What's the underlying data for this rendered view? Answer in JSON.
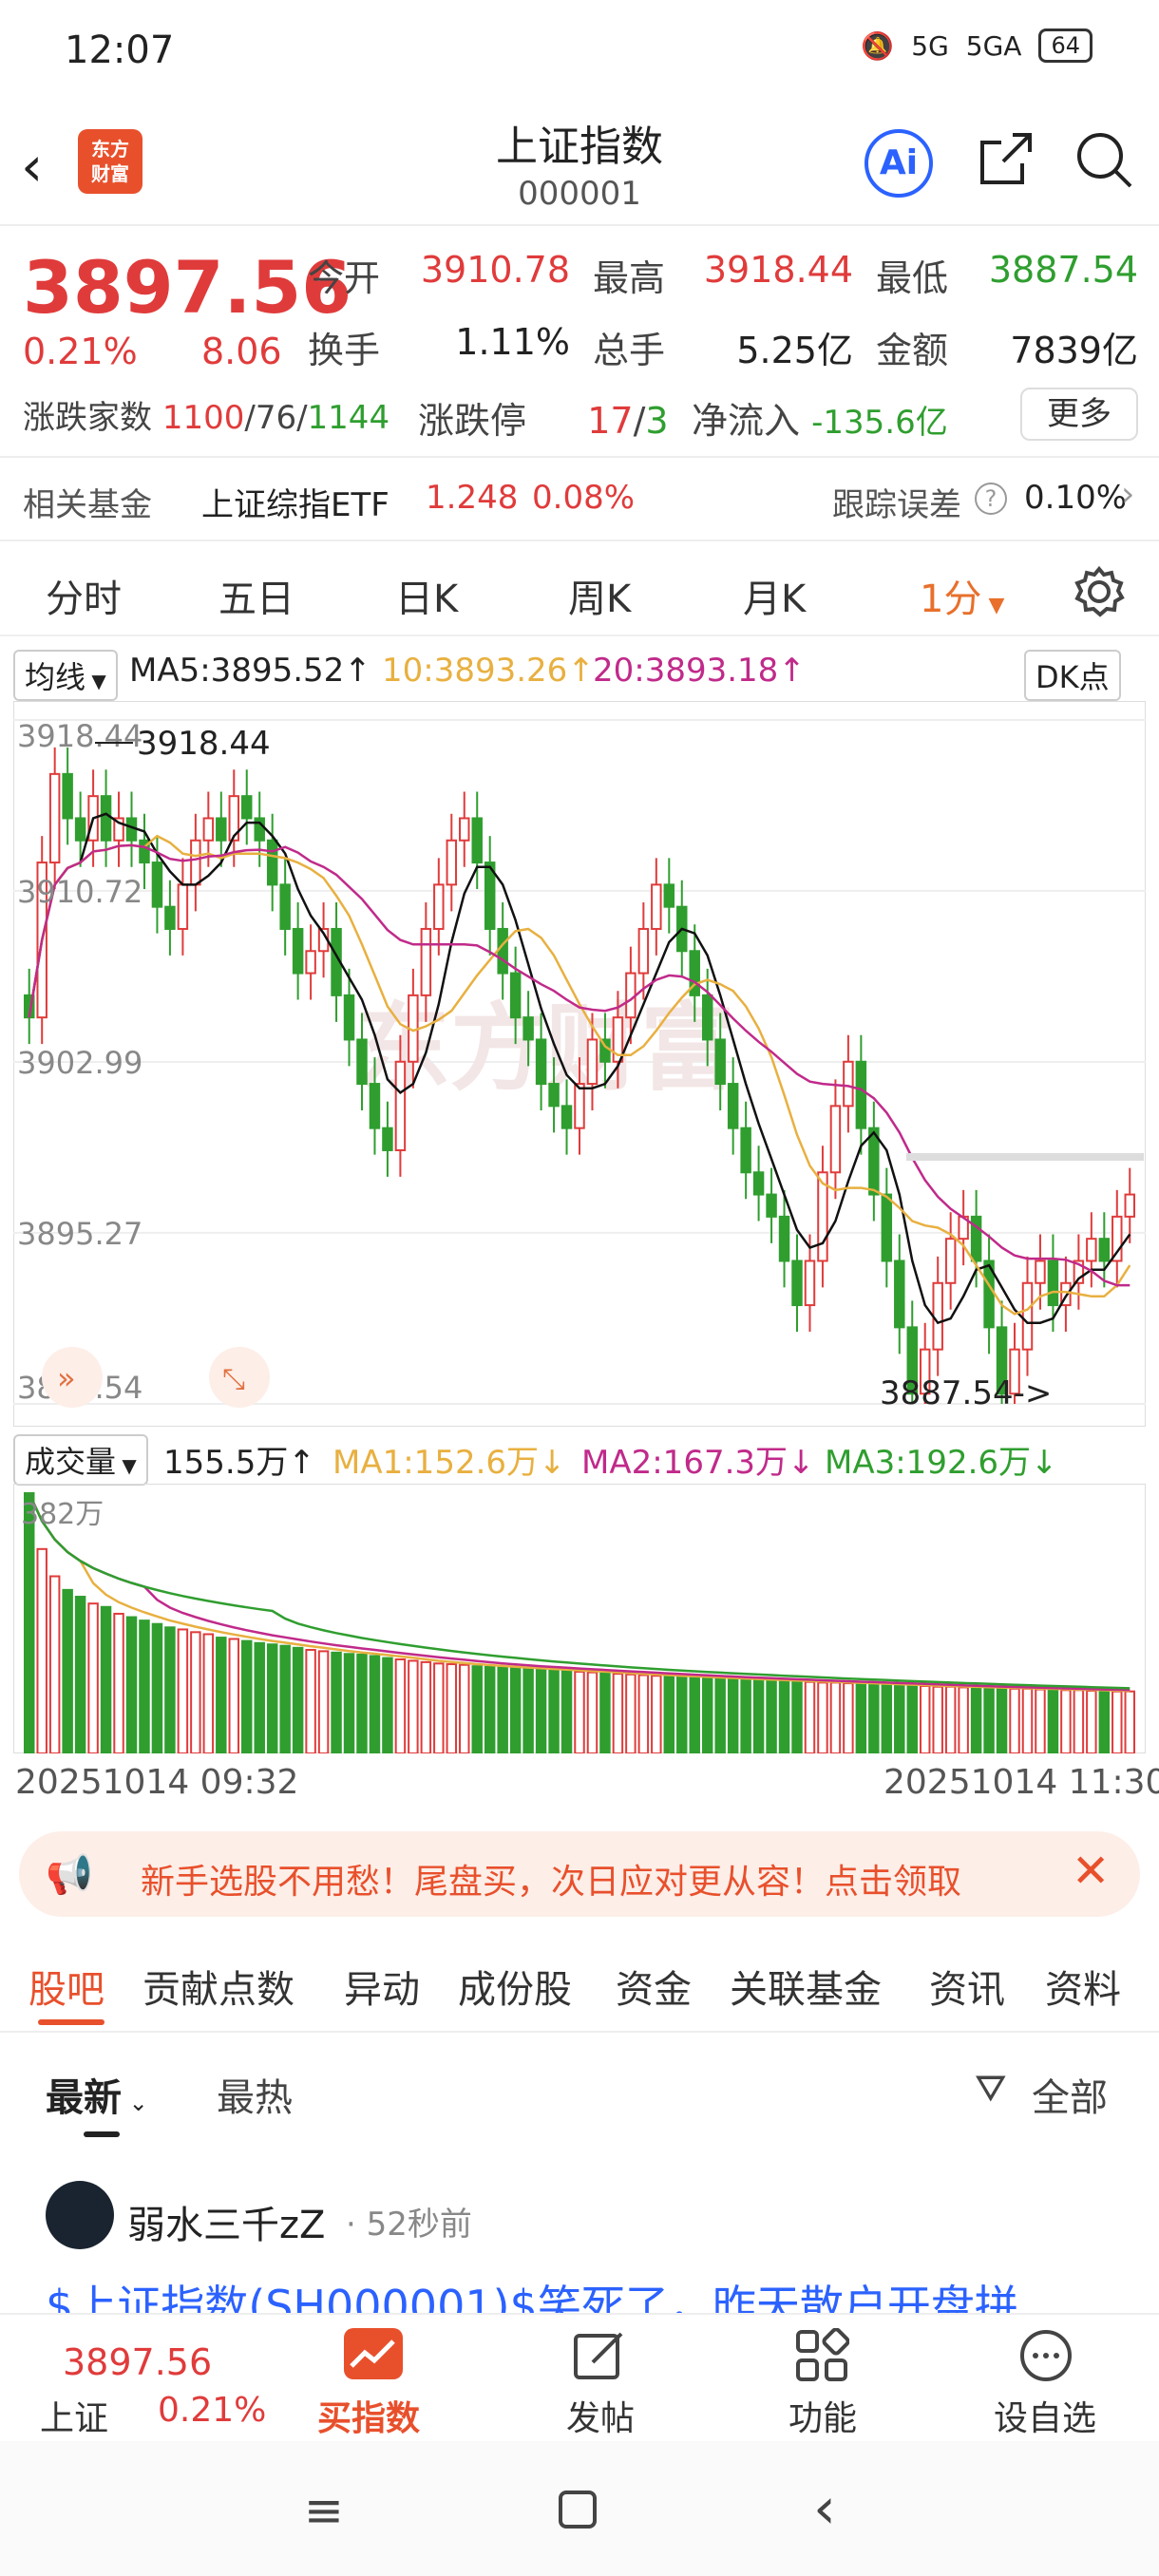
{
  "status": {
    "time": "12:07",
    "network1": "5G",
    "network2": "5GA",
    "battery": "64"
  },
  "header": {
    "title": "上证指数",
    "code": "000001",
    "logo_text": "东方\n财富",
    "ai_label": "Ai"
  },
  "quote": {
    "price": "3897.56",
    "change_pct": "0.21%",
    "change": "8.06",
    "open_label": "今开",
    "open": "3910.78",
    "high_label": "最高",
    "high": "3918.44",
    "low_label": "最低",
    "low": "3887.54",
    "turnover_label": "换手",
    "turnover": "1.11%",
    "volume_label": "总手",
    "volume": "5.25亿",
    "amount_label": "金额",
    "amount": "7839亿",
    "breadth_label": "涨跌家数",
    "breadth_up": "1100",
    "breadth_flat": "76",
    "breadth_down": "1144",
    "limit_label": "涨跌停",
    "limit_up": "17",
    "limit_down": "3",
    "netflow_label": "净流入",
    "netflow": "-135.6亿",
    "more_label": "更多"
  },
  "fund": {
    "label": "相关基金",
    "name": "上证综指ETF",
    "price": "1.248",
    "pct": "0.08%",
    "tracking_label": "跟踪误差",
    "tracking": "0.10%"
  },
  "kline_tabs": [
    "分时",
    "五日",
    "日K",
    "周K",
    "月K",
    "1分"
  ],
  "ma": {
    "selector": "均线",
    "ma5": "MA5:3895.52↑",
    "ma10": "10:3893.26↑",
    "ma20": "20:3893.18↑",
    "dk": "DK点"
  },
  "chart_data": {
    "type": "candlestick",
    "y_ticks": [
      "3918.44",
      "3910.72",
      "3902.99",
      "3895.27",
      "3887.54"
    ],
    "ylim": [
      3887.54,
      3918.44
    ],
    "high_annotation": "3918.44",
    "low_annotation": "3887.54->",
    "start_time": "20251014 09:32",
    "end_time": "20251014 11:30",
    "closes": [
      3905,
      3912,
      3916,
      3914,
      3913,
      3915,
      3913,
      3914,
      3913,
      3912,
      3910,
      3909,
      3911,
      3913,
      3914,
      3913,
      3915,
      3914,
      3913,
      3911,
      3909,
      3907,
      3908,
      3909,
      3906,
      3904,
      3902,
      3900,
      3899,
      3903,
      3906,
      3909,
      3911,
      3913,
      3914,
      3912,
      3909,
      3907,
      3905,
      3904,
      3902,
      3901,
      3900,
      3902,
      3904,
      3903,
      3905,
      3907,
      3909,
      3911,
      3910,
      3908,
      3906,
      3904,
      3902,
      3900,
      3898,
      3897,
      3896,
      3894,
      3892,
      3894,
      3898,
      3901,
      3903,
      3900,
      3897,
      3894,
      3891,
      3888,
      3890,
      3893,
      3895,
      3896,
      3894,
      3891,
      3888,
      3890,
      3893,
      3894,
      3892,
      3893,
      3894,
      3895,
      3894,
      3896,
      3897
    ],
    "volume": {
      "label": "成交量",
      "value": "155.5万↑",
      "ma1": "MA1:152.6万↓",
      "ma2": "MA2:167.3万↓",
      "ma3": "MA3:192.6万↓",
      "max_label": "382万",
      "values": [
        382,
        300,
        260,
        240,
        230,
        220,
        215,
        205,
        200,
        195,
        190,
        185,
        182,
        178,
        175,
        170,
        168,
        165,
        162,
        160,
        158,
        155,
        152,
        150,
        148,
        146,
        145,
        143,
        140,
        138,
        136,
        134,
        132,
        131,
        130,
        128,
        127,
        126,
        125,
        124,
        123,
        122,
        121,
        120,
        119,
        118,
        117,
        116,
        115,
        114,
        113,
        112,
        112,
        111,
        110,
        109,
        108,
        108,
        107,
        106,
        106,
        105,
        104,
        104,
        103,
        102,
        102,
        101,
        100,
        100,
        99,
        98,
        98,
        97,
        97,
        96,
        96,
        95,
        95,
        94,
        94,
        93,
        93,
        92,
        92,
        91,
        91
      ]
    }
  },
  "banner": {
    "text": "新手选股不用愁！尾盘买，次日应对更从容！点击领取"
  },
  "news_tabs": [
    "股吧",
    "贡献点数",
    "异动",
    "成份股",
    "资金",
    "关联基金",
    "资讯",
    "资料"
  ],
  "sort": {
    "latest": "最新",
    "hot": "最热",
    "filter": "全部"
  },
  "post": {
    "user": "弱水三千zZ",
    "time": "52秒前",
    "text": "$上证指数(SH000001)$笑死了，昨天散户开盘拼"
  },
  "footer": {
    "index_name": "上证",
    "price": "3897.56",
    "pct": "0.21%",
    "buy_label": "买指数",
    "post_label": "发帖",
    "func_label": "功能",
    "watch_label": "设自选"
  }
}
